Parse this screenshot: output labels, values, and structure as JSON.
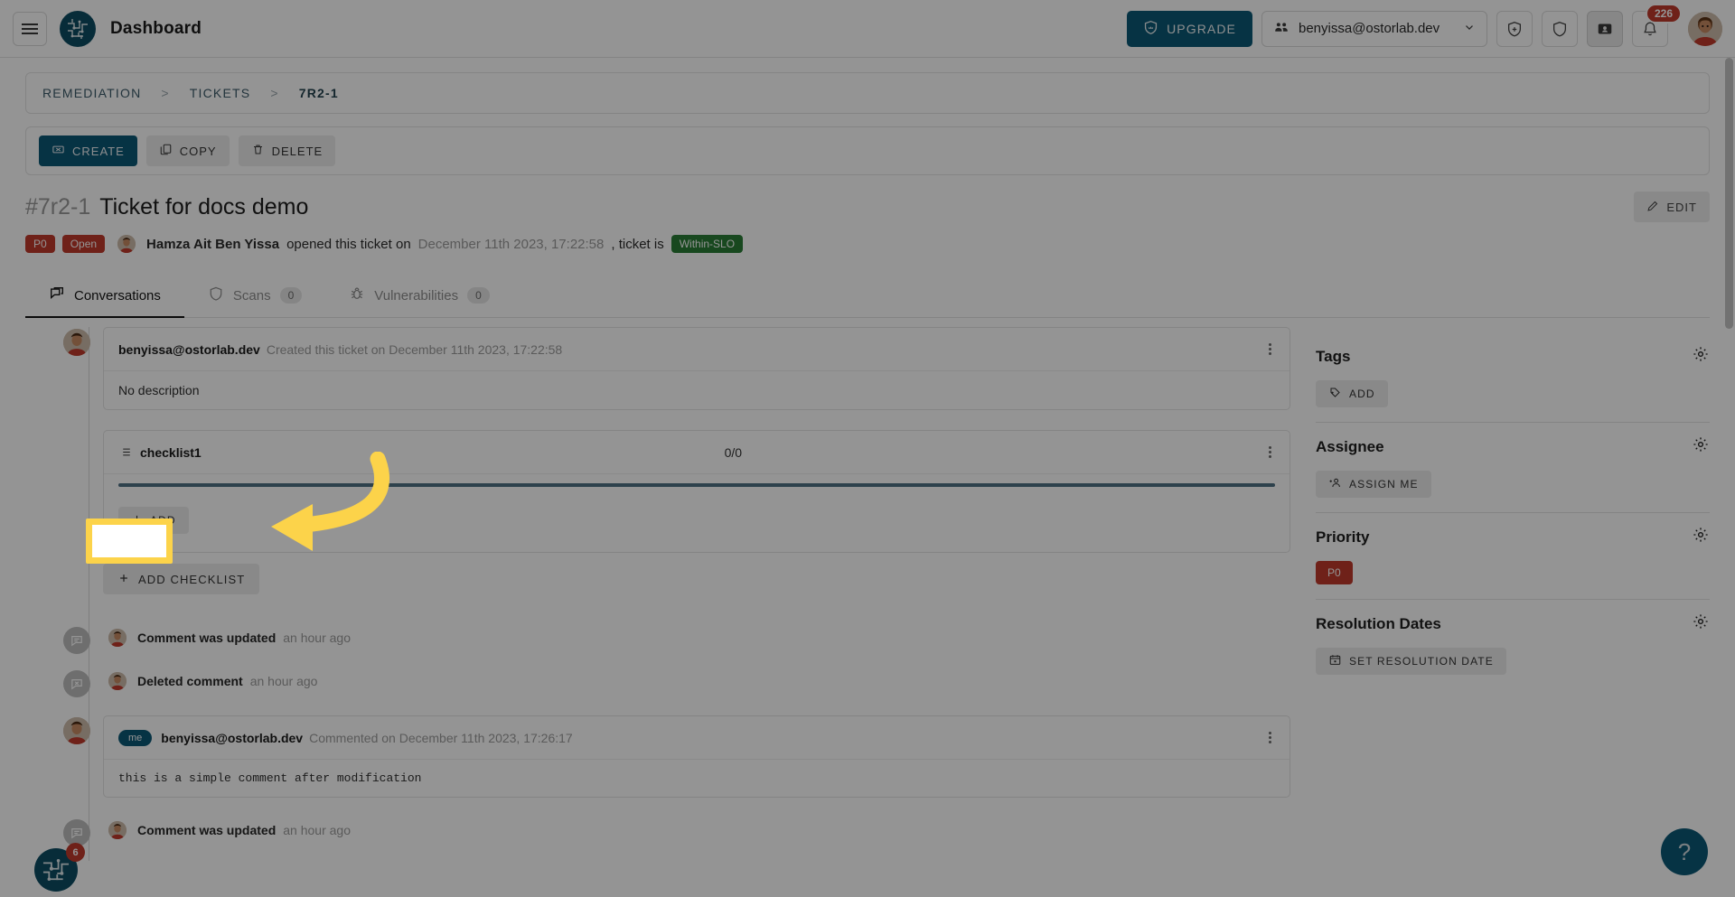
{
  "topbar": {
    "menu_icon": "hamburger-icon",
    "logo_icon": "ostorlab-logo-icon",
    "title": "Dashboard",
    "upgrade_label": "UPGRADE",
    "upgrade_icon": "shield-crown-icon",
    "upgrade_color": "#0c5976",
    "org": "benyissa@ostorlab.dev",
    "org_icon": "group-icon",
    "caret_icon": "chevron-down-icon",
    "actions": [
      {
        "name": "shield-plus-icon",
        "active": false
      },
      {
        "name": "shield-icon",
        "active": false
      },
      {
        "name": "id-card-icon",
        "active": true
      },
      {
        "name": "bell-icon",
        "active": false
      }
    ],
    "notification_count": "226",
    "avatar_name": "user-avatar"
  },
  "breadcrumb": {
    "items": [
      "REMEDIATION",
      "TICKETS",
      "7R2-1"
    ],
    "separator": ">"
  },
  "toolbar": {
    "create_label": "CREATE",
    "create_icon": "ticket-icon",
    "copy_label": "COPY",
    "copy_icon": "copy-icon",
    "delete_label": "DELETE",
    "delete_icon": "trash-icon"
  },
  "ticket": {
    "id": "#7r2-1",
    "name": "Ticket for docs demo",
    "edit_label": "EDIT",
    "edit_icon": "pencil-icon",
    "priority_badge": "P0",
    "status_badge": "Open",
    "author": "Hamza Ait Ben Yissa",
    "action_text": "opened this ticket on",
    "created_at": "December 11th 2023, 17:22:58",
    "slo_prefix": ", ticket is",
    "slo_badge": "Within-SLO",
    "badge_red": "#c0392b",
    "badge_green": "#2a7d36"
  },
  "tabs": [
    {
      "label": "Conversations",
      "icon": "chat-icon",
      "count": null,
      "active": true
    },
    {
      "label": "Scans",
      "icon": "shield-icon",
      "count": "0",
      "active": false
    },
    {
      "label": "Vulnerabilities",
      "icon": "bug-icon",
      "count": "0",
      "active": false
    }
  ],
  "conversation": {
    "created_card": {
      "author": "benyissa@ostorlab.dev",
      "action": "Created this ticket on December 11th 2023, 17:22:58",
      "body": "No description",
      "kebab_icon": "more-vertical-icon"
    },
    "checklist": {
      "icon": "list-icon",
      "name": "checklist1",
      "count": "0/0",
      "kebab_icon": "more-vertical-icon",
      "progress_percent": 100,
      "progress_color": "#4f7183",
      "add_label": "ADD",
      "add_icon": "plus-icon"
    },
    "add_checklist_label": "ADD CHECKLIST",
    "add_checklist_icon": "plus-icon",
    "activities": [
      {
        "icon": "comment-icon",
        "text": "Comment was updated",
        "when": "an hour ago"
      },
      {
        "icon": "comment-deleted-icon",
        "text": "Deleted comment",
        "when": "an hour ago"
      }
    ],
    "comment_card": {
      "me_chip": "me",
      "author": "benyissa@ostorlab.dev",
      "action": "Commented on December 11th 2023, 17:26:17",
      "body": "this is a simple comment after modification",
      "kebab_icon": "more-vertical-icon"
    },
    "last_activity": {
      "text": "Comment was updated",
      "when": "an hour ago"
    }
  },
  "sidebar": {
    "sections": [
      {
        "title": "Tags",
        "gear_icon": "gear-icon",
        "button_label": "ADD",
        "button_icon": "tag-plus-icon",
        "chip": null
      },
      {
        "title": "Assignee",
        "gear_icon": "gear-icon",
        "button_label": "ASSIGN ME",
        "button_icon": "person-plus-icon",
        "chip": null
      },
      {
        "title": "Priority",
        "gear_icon": "gear-icon",
        "button_label": null,
        "button_icon": null,
        "chip": "P0"
      },
      {
        "title": "Resolution Dates",
        "gear_icon": "gear-icon",
        "button_label": "SET RESOLUTION DATE",
        "button_icon": "calendar-icon",
        "chip": null
      }
    ]
  },
  "widgets": {
    "chat_badge": "6",
    "chat_icon": "ostorlab-logo-icon",
    "help_label": "?",
    "help_color": "#0c5976"
  },
  "annotation": {
    "highlight_color": "#fcd34a",
    "target": "checklist-add-button",
    "arrow_icon": "curved-arrow-left-icon"
  }
}
